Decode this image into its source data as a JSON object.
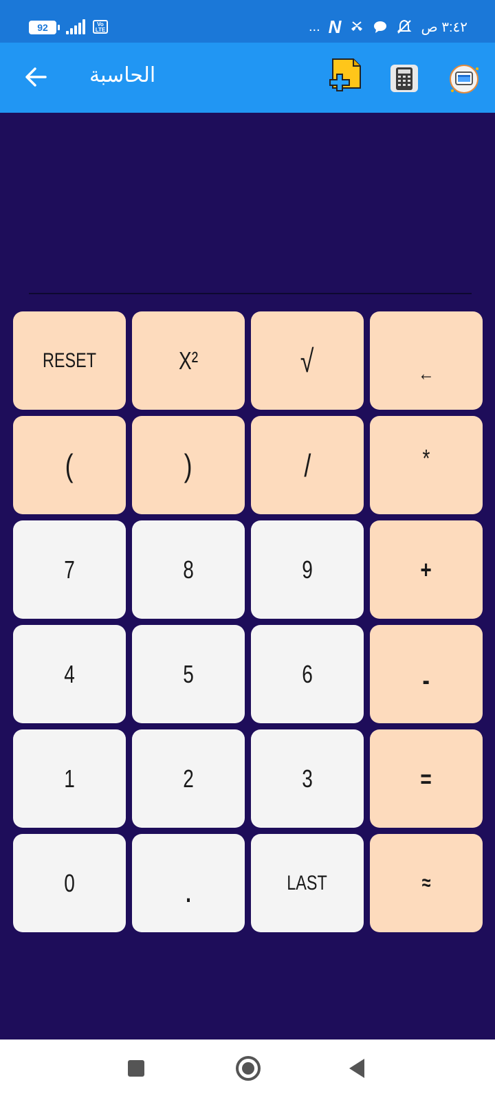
{
  "status_bar": {
    "battery": "92",
    "volte": "Vo LTE",
    "dots": "...",
    "time": "٣:٤٢ ص"
  },
  "app_bar": {
    "title": "الحاسبة"
  },
  "display": {
    "value": ""
  },
  "keypad": {
    "reset": "RESET",
    "square": "X²",
    "sqrt": "√",
    "backspace": "←",
    "open_paren": "(",
    "close_paren": ")",
    "divide": "/",
    "multiply": "*",
    "seven": "7",
    "eight": "8",
    "nine": "9",
    "plus": "+",
    "four": "4",
    "five": "5",
    "six": "6",
    "minus": "-",
    "one": "1",
    "two": "2",
    "three": "3",
    "equals": "=",
    "zero": "0",
    "dot": ".",
    "last": "LAST",
    "approx": "≈"
  },
  "colors": {
    "background": "#1e0d5a",
    "app_bar": "#2196f3",
    "status_bar": "#1b78d8",
    "operator_key": "#fddbbd",
    "number_key": "#f4f4f4"
  }
}
